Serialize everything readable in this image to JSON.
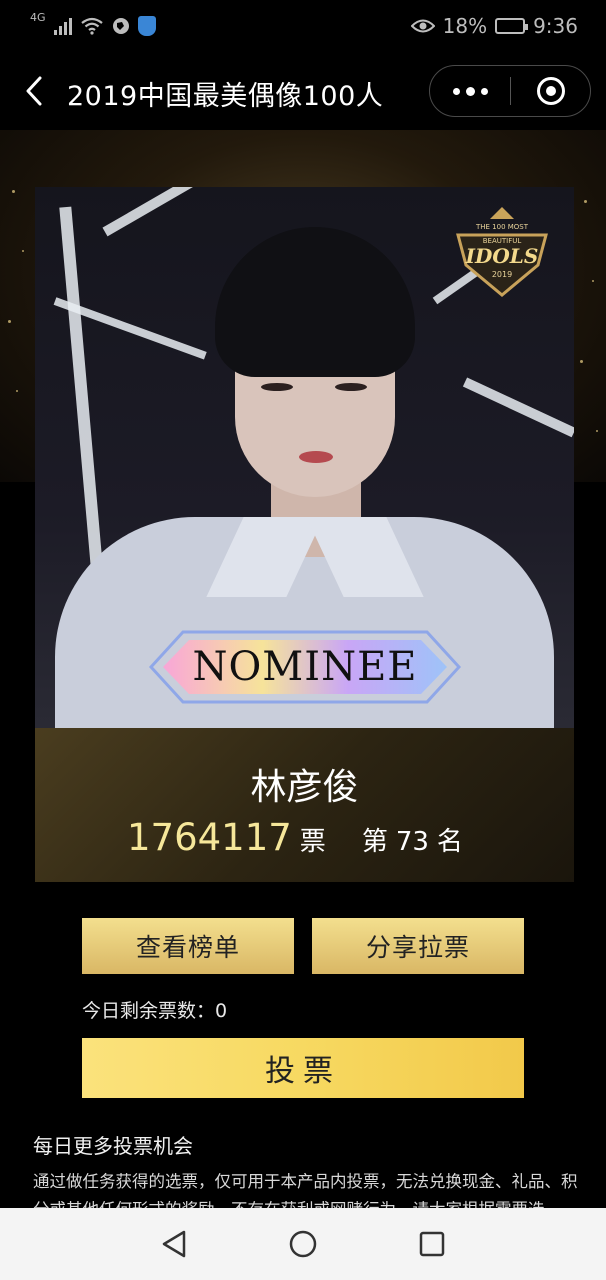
{
  "status_bar": {
    "network": "4G",
    "battery_percent": "18%",
    "time": "9:36",
    "icons": [
      "signal-icon",
      "wifi-icon",
      "globe-icon",
      "shield-icon",
      "eye-icon",
      "battery-icon"
    ]
  },
  "nav": {
    "title": "2019中国最美偶像100人",
    "back_icon": "chevron-left-icon",
    "more_icon": "more-dots-icon",
    "close_icon": "target-circle-icon"
  },
  "banner": {
    "badge_lines": [
      "THE 100 MOST",
      "BEAUTIFUL",
      "IDOLS",
      "2019"
    ],
    "nominee_label": "NOMINEE"
  },
  "candidate": {
    "name": "林彦俊",
    "votes": "1764117",
    "votes_unit": "票",
    "rank_prefix": "第",
    "rank": "73",
    "rank_suffix": "名"
  },
  "actions": {
    "view_ranking": "查看榜单",
    "share_vote": "分享拉票",
    "remaining_votes": "今日剩余票数：0",
    "vote_button": "投票"
  },
  "more": {
    "title": "每日更多投票机会",
    "description": "通过做任务获得的选票，仅可用于本产品内投票，无法兑换现金、礼品、积分或其他任何形式的奖励，不存在获利或网赌行为，请大家根据需要选"
  },
  "colors": {
    "gold_button": "#e6c877",
    "vote_button": "#f7d961",
    "votes_highlight": "#f6e79a"
  }
}
